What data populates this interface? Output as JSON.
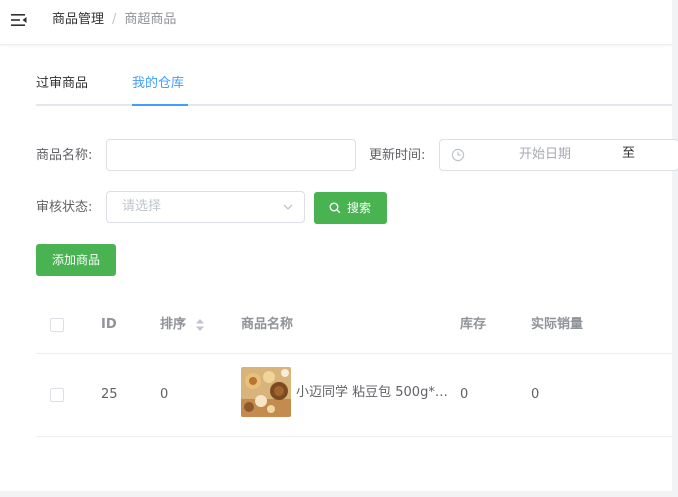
{
  "header": {
    "breadcrumb": [
      "商品管理",
      "商超商品"
    ],
    "separator": "/"
  },
  "tabs": [
    {
      "label": "过审商品",
      "active": false
    },
    {
      "label": "我的仓库",
      "active": true
    }
  ],
  "filters": {
    "name_label": "商品名称:",
    "name_value": "",
    "update_time_label": "更新时间:",
    "start_date_placeholder": "开始日期",
    "range_separator": "至",
    "status_label": "审核状态:",
    "status_placeholder": "请选择",
    "search_button": "搜索"
  },
  "actions": {
    "add_button": "添加商品"
  },
  "table": {
    "columns": [
      "ID",
      "排序",
      "商品名称",
      "库存",
      "实际销量"
    ],
    "rows": [
      {
        "id": "25",
        "sort": "0",
        "name": "小迈同学 粘豆包 500g*…",
        "stock": "0",
        "sales": "0"
      }
    ]
  },
  "colors": {
    "accent": "#409eff",
    "primary_button": "#48b350"
  },
  "icons": [
    "menu-fold-icon",
    "clock-icon",
    "chevron-down-icon",
    "search-icon",
    "sort-icon"
  ]
}
